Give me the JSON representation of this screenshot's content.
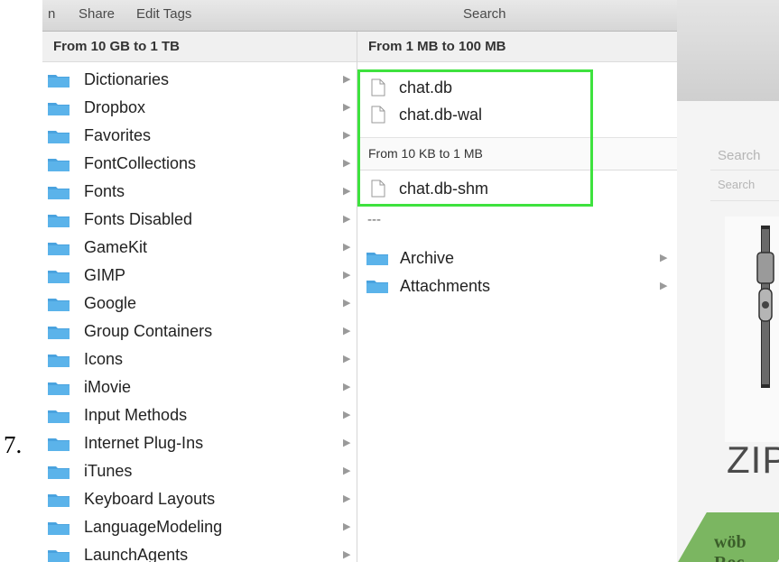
{
  "step_number": "7.",
  "toolbar": {
    "share": "Share",
    "edit_tags": "Edit Tags",
    "search": "Search",
    "cut_prefix": "n"
  },
  "column1": {
    "group_header": "From 10 GB to 1 TB",
    "items": [
      "Dictionaries",
      "Dropbox",
      "Favorites",
      "FontCollections",
      "Fonts",
      "Fonts Disabled",
      "GameKit",
      "GIMP",
      "Google",
      "Group Containers",
      "Icons",
      "iMovie",
      "Input Methods",
      "Internet Plug-Ins",
      "iTunes",
      "Keyboard Layouts",
      "LanguageModeling",
      "LaunchAgents"
    ]
  },
  "column2": {
    "group1_header": "From 1 MB to 100 MB",
    "group1_files": [
      "chat.db",
      "chat.db-wal"
    ],
    "group2_header": "From 10 KB to 1 MB",
    "group2_files": [
      "chat.db-shm"
    ],
    "ellipsis": "---",
    "folders": [
      "Archive",
      "Attachments"
    ]
  },
  "background_app": {
    "search_label": "Search",
    "search_placeholder": "Search",
    "zip_label": "ZIP",
    "watermark": "wöb Roc"
  },
  "colors": {
    "highlight": "#3ee23e",
    "folder": "#4aa3df"
  }
}
